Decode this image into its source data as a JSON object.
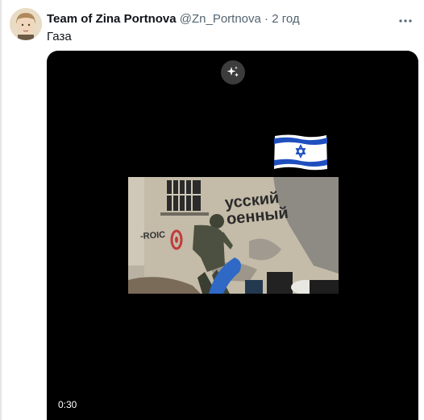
{
  "tweet": {
    "author_name": "Team of Zina Portnova",
    "handle": "@Zn_Portnova",
    "separator": "·",
    "time": "2 год",
    "text": "Газа",
    "more_icon": "more-dots-icon",
    "avatar_icon": "avatar-portrait"
  },
  "video": {
    "duration": "0:30",
    "ai_button_icon": "sparkle-icon",
    "overlay_flag": "israel-flag",
    "wall_text_line1": "усский",
    "wall_text_line2": "оенный",
    "wall_text_left": "-ROIC"
  },
  "colors": {
    "text_primary": "#0f1419",
    "text_secondary": "#536471",
    "video_bg": "#000000",
    "flag_blue": "#1f4fbf"
  }
}
